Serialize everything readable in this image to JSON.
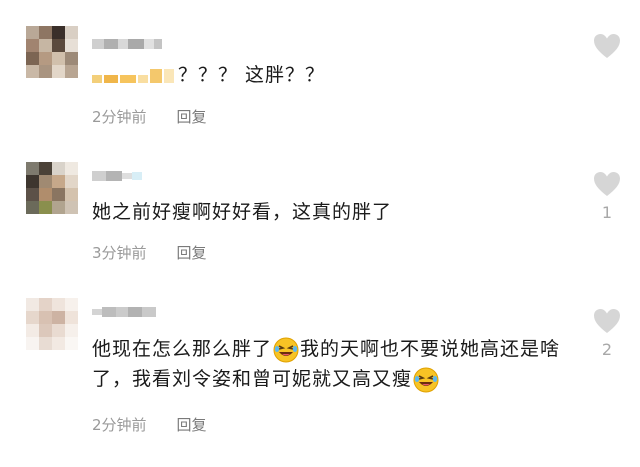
{
  "comments": [
    {
      "text": "？？？ 这胖？？",
      "time": "2分钟前",
      "reply_label": "回复",
      "like_count": ""
    },
    {
      "text": "她之前好瘦啊好好看，这真的胖了",
      "time": "3分钟前",
      "reply_label": "回复",
      "like_count": "1"
    },
    {
      "text_part1": "他现在怎么那么胖了",
      "text_part2": "我的天啊也不要说她高还是啥了，我看刘令姿和曾可妮就又高又瘦",
      "time": "2分钟前",
      "reply_label": "回复",
      "like_count": "2"
    }
  ],
  "icons": {
    "like": "heart-icon",
    "emoji": "rolling-on-floor-laughing-emoji"
  },
  "colors": {
    "like_heart": "#d6d6d6",
    "meta_text": "#9a9a9a",
    "body_text": "#1b1b1b"
  }
}
